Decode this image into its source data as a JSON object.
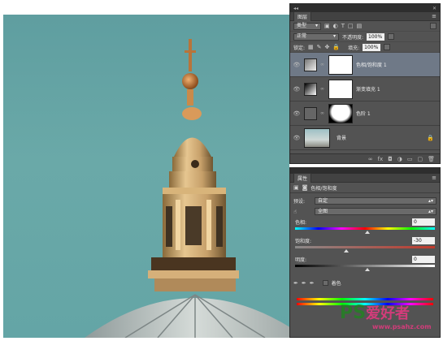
{
  "layers_panel": {
    "tab": "图层",
    "filter_kind": "类型",
    "blend_mode": "正常",
    "opacity_label": "不透明度:",
    "opacity_value": "100%",
    "lock_label": "锁定:",
    "fill_label": "填充:",
    "fill_value": "100%",
    "layers": [
      {
        "name": "色相/饱和度 1",
        "selected": true
      },
      {
        "name": "渐变填充 1",
        "selected": false
      },
      {
        "name": "色阶 1",
        "selected": false
      },
      {
        "name": "背景",
        "selected": false
      }
    ]
  },
  "properties_panel": {
    "tab": "属性",
    "title": "色相/饱和度",
    "preset_label": "预设:",
    "preset_value": "自定",
    "channel_value": "全图",
    "hue_label": "色相:",
    "hue_value": "0",
    "saturation_label": "饱和度:",
    "saturation_value": "-30",
    "lightness_label": "明度:",
    "lightness_value": "0",
    "colorize_label": "着色"
  },
  "watermark": {
    "brand_latin": "PS",
    "brand_cn": "爱好者",
    "url": "www.psahz.com"
  },
  "colors": {
    "panel_bg": "#535353",
    "selected_layer": "#6f7987",
    "sky": "#64a5a6"
  }
}
